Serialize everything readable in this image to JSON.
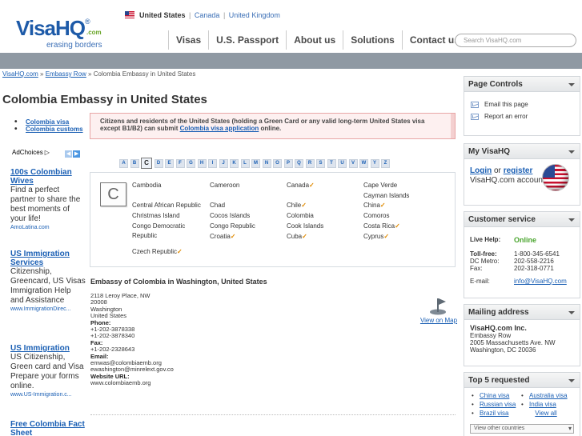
{
  "header": {
    "logo_text": "VisaHQ",
    "logo_com": ".com",
    "logo_reg": "®",
    "tagline": "erasing borders",
    "countries": {
      "current": "United States",
      "alt1": "Canada",
      "alt2": "United Kingdom",
      "sep": "|"
    },
    "nav": [
      "Visas",
      "U.S. Passport",
      "About us",
      "Solutions",
      "Contact us"
    ],
    "search_placeholder": "Search VisaHQ.com"
  },
  "breadcrumb": {
    "home": "VisaHQ.com",
    "sep": "»",
    "row": "Embassy Row",
    "current": "Colombia Embassy in United States"
  },
  "page_title": "Colombia Embassy in United States",
  "left": {
    "links": [
      "Colombia visa",
      "Colombia customs"
    ],
    "adchoices": "AdChoices",
    "ads": [
      {
        "title": "100s Colombian Wives",
        "body": "Find a perfect partner to share the best moments of your life!",
        "url": "AmoLatina.com"
      },
      {
        "title": "US Immigration Services",
        "body": "Citizenship, Greencard, US Visas Immigration Help and Assistance",
        "url": "www.ImmigrationDirec..."
      },
      {
        "title": "US Immigration",
        "body": "US Citizenship, Green card and Visa Prepare your forms online.",
        "url": "www.US-Immigration.c..."
      },
      {
        "title": "Free Colombia Fact Sheet",
        "body": "",
        "url": ""
      }
    ]
  },
  "alert": {
    "text_before": "Citizens and residents of the United States (holding a Green Card or any valid long-term United States visa except B1/B2) can submit ",
    "link": "Colombia visa application",
    "text_after": " online."
  },
  "letters": [
    "A",
    "B",
    "C",
    "D",
    "E",
    "F",
    "G",
    "H",
    "I",
    "J",
    "K",
    "L",
    "M",
    "N",
    "O",
    "P",
    "Q",
    "R",
    "S",
    "T",
    "U",
    "V",
    "W",
    "Y",
    "Z"
  ],
  "active_letter": "C",
  "countries_grid": {
    "col1": [
      "Cambodia",
      "Central African Republic",
      "Christmas Island",
      "Congo Democratic Republic",
      "Czech Republic"
    ],
    "col2": [
      "Cameroon",
      "Chad",
      "Cocos Islands",
      "Congo Republic",
      "Croatia"
    ],
    "col3": [
      "Canada",
      "Chile",
      "Colombia",
      "Cook Islands",
      "Cuba"
    ],
    "col4": [
      "Cape Verde",
      "Cayman Islands",
      "China",
      "Comoros",
      "Costa Rica",
      "Cyprus"
    ],
    "check": "✓"
  },
  "embassy": {
    "title": "Embassy of Colombia in Washington, United States",
    "address": [
      "2118 Leroy Place, NW",
      "20008",
      "Washington",
      "United States"
    ],
    "phone_label": "Phone:",
    "phones": [
      "+1-202-3878338",
      "+1-202-3878340"
    ],
    "fax_label": "Fax:",
    "fax": "+1-202-2328643",
    "email_label": "Email:",
    "emails": [
      "emwas@colombiaemb.org",
      "ewashington@minrelext.gov.co"
    ],
    "website_label": "Website URL:",
    "website": "www.colombiaemb.org",
    "map_link": "View on Map"
  },
  "sidebar": {
    "controls": {
      "title": "Page Controls",
      "email": "Email this page",
      "report": "Report an error"
    },
    "myvisa": {
      "title": "My VisaHQ",
      "login": "Login",
      "or": "or",
      "register": "register",
      "account": "VisaHQ.com account"
    },
    "service": {
      "title": "Customer service",
      "live_label": "Live Help:",
      "live_status": "Online",
      "rows": [
        {
          "k": "Toll-free:",
          "v": "1-800-345-6541"
        },
        {
          "k": "DC Metro:",
          "v": "202-558-2216"
        },
        {
          "k": "Fax:",
          "v": "202-318-0771"
        }
      ],
      "email_label": "E-mail:",
      "email": "info@VisaHQ.com"
    },
    "mailing": {
      "title": "Mailing address",
      "company": "VisaHQ.com Inc.",
      "lines": [
        "Embassy Row",
        "2005 Massachusetts Ave. NW",
        "Washington, DC 20036"
      ]
    },
    "top5": {
      "title": "Top 5 requested",
      "items": [
        "China visa",
        "Australia visa",
        "Russian visa",
        "India visa",
        "Brazil visa",
        "View all"
      ],
      "other": "View other countries"
    }
  },
  "colors": {
    "accent": "#1a5fb4",
    "bar": "#8f99a3",
    "online": "#4aa52e",
    "check": "#e08a00"
  }
}
